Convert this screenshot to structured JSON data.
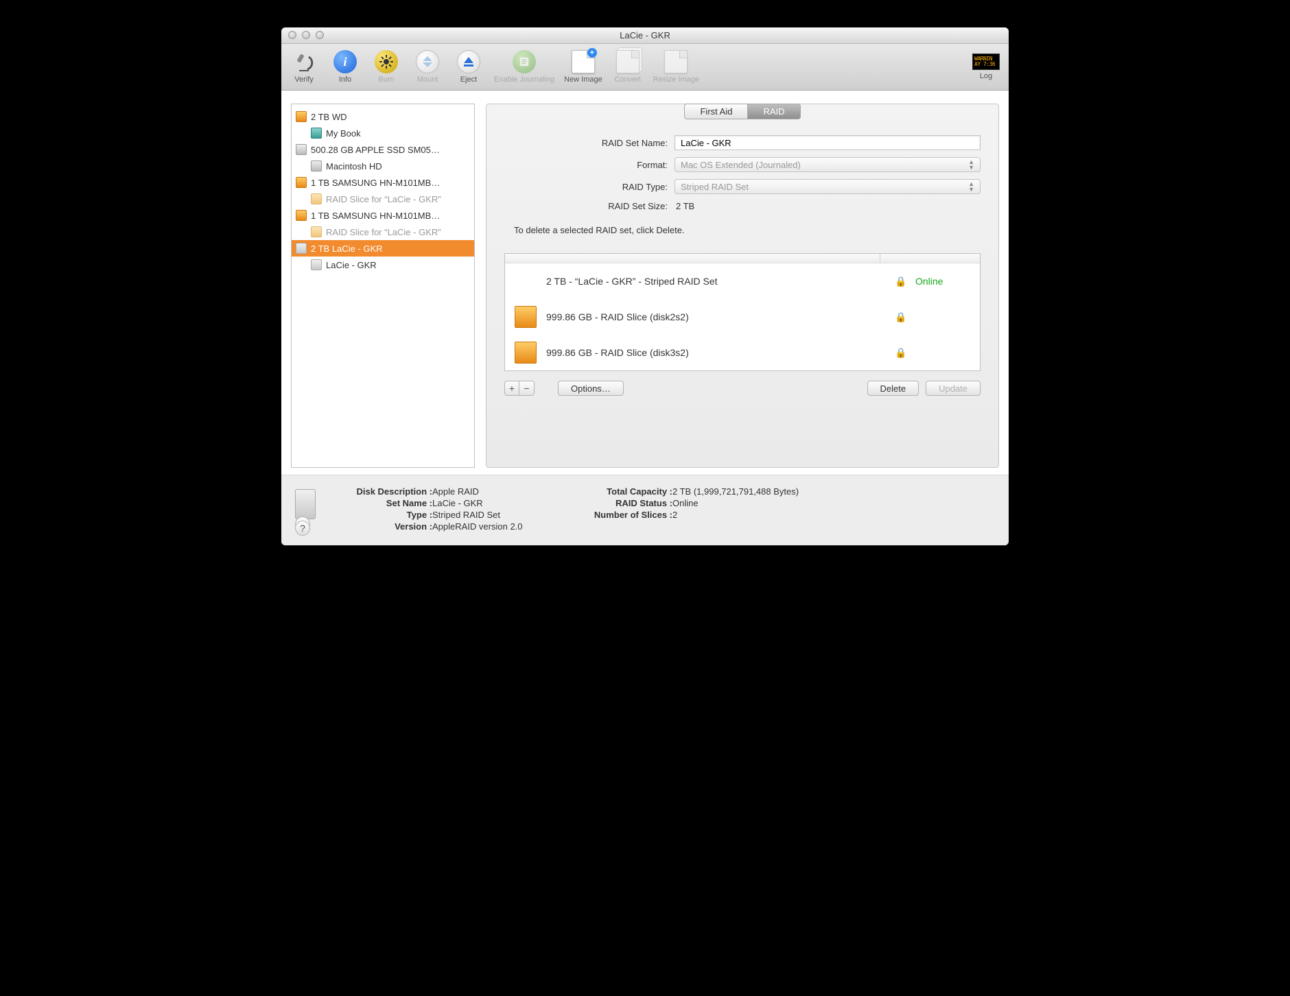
{
  "window": {
    "title": "LaCie - GKR"
  },
  "toolbar": {
    "verify": "Verify",
    "info": "Info",
    "burn": "Burn",
    "mount": "Mount",
    "eject": "Eject",
    "enable_journaling": "Enable Journaling",
    "new_image": "New Image",
    "convert": "Convert",
    "resize_image": "Resize Image",
    "log": "Log",
    "log_text1": "WARNIN",
    "log_text2": "AY 7:36"
  },
  "sidebar": {
    "items": [
      {
        "icon": "orange",
        "label": "2 TB WD",
        "indent": false
      },
      {
        "icon": "teal",
        "label": "My Book",
        "indent": true
      },
      {
        "icon": "gray",
        "label": "500.28 GB APPLE SSD SM05…",
        "indent": false
      },
      {
        "icon": "gray",
        "label": "Macintosh HD",
        "indent": true
      },
      {
        "icon": "orange",
        "label": "1 TB SAMSUNG HN-M101MB…",
        "indent": false
      },
      {
        "icon": "orange-dim",
        "label": "RAID Slice for “LaCie - GKR”",
        "indent": true,
        "dim": true
      },
      {
        "icon": "orange",
        "label": "1 TB SAMSUNG HN-M101MB…",
        "indent": false
      },
      {
        "icon": "orange-dim",
        "label": "RAID Slice for “LaCie - GKR”",
        "indent": true,
        "dim": true
      },
      {
        "icon": "server",
        "label": "2 TB LaCie - GKR",
        "indent": false,
        "selected": true
      },
      {
        "icon": "server",
        "label": "LaCie - GKR",
        "indent": true
      }
    ]
  },
  "tabs": {
    "first_aid": "First Aid",
    "raid": "RAID"
  },
  "form": {
    "name_label": "RAID Set Name:",
    "name_value": "LaCie - GKR",
    "format_label": "Format:",
    "format_value": "Mac OS Extended (Journaled)",
    "type_label": "RAID Type:",
    "type_value": "Striped RAID Set",
    "size_label": "RAID Set Size:",
    "size_value": "2 TB",
    "hint": "To delete a selected RAID set, click Delete."
  },
  "members": [
    {
      "icon": false,
      "label": "2 TB - “LaCie - GKR” - Striped RAID Set",
      "lock": true,
      "status": "Online"
    },
    {
      "icon": true,
      "label": "999.86 GB - RAID Slice (disk2s2)",
      "lock": true,
      "status": ""
    },
    {
      "icon": true,
      "label": "999.86 GB - RAID Slice (disk3s2)",
      "lock": true,
      "status": ""
    }
  ],
  "buttons": {
    "options": "Options…",
    "delete": "Delete",
    "update": "Update"
  },
  "footer": {
    "left": {
      "disk_description_k": "Disk Description :",
      "disk_description_v": " Apple RAID",
      "set_name_k": "Set Name :",
      "set_name_v": " LaCie - GKR",
      "type_k": "Type :",
      "type_v": " Striped RAID Set",
      "version_k": "Version :",
      "version_v": " AppleRAID version 2.0"
    },
    "right": {
      "total_capacity_k": "Total Capacity :",
      "total_capacity_v": " 2 TB (1,999,721,791,488 Bytes)",
      "raid_status_k": "RAID Status :",
      "raid_status_v": " Online",
      "num_slices_k": "Number of Slices :",
      "num_slices_v": " 2"
    },
    "help": "?"
  }
}
